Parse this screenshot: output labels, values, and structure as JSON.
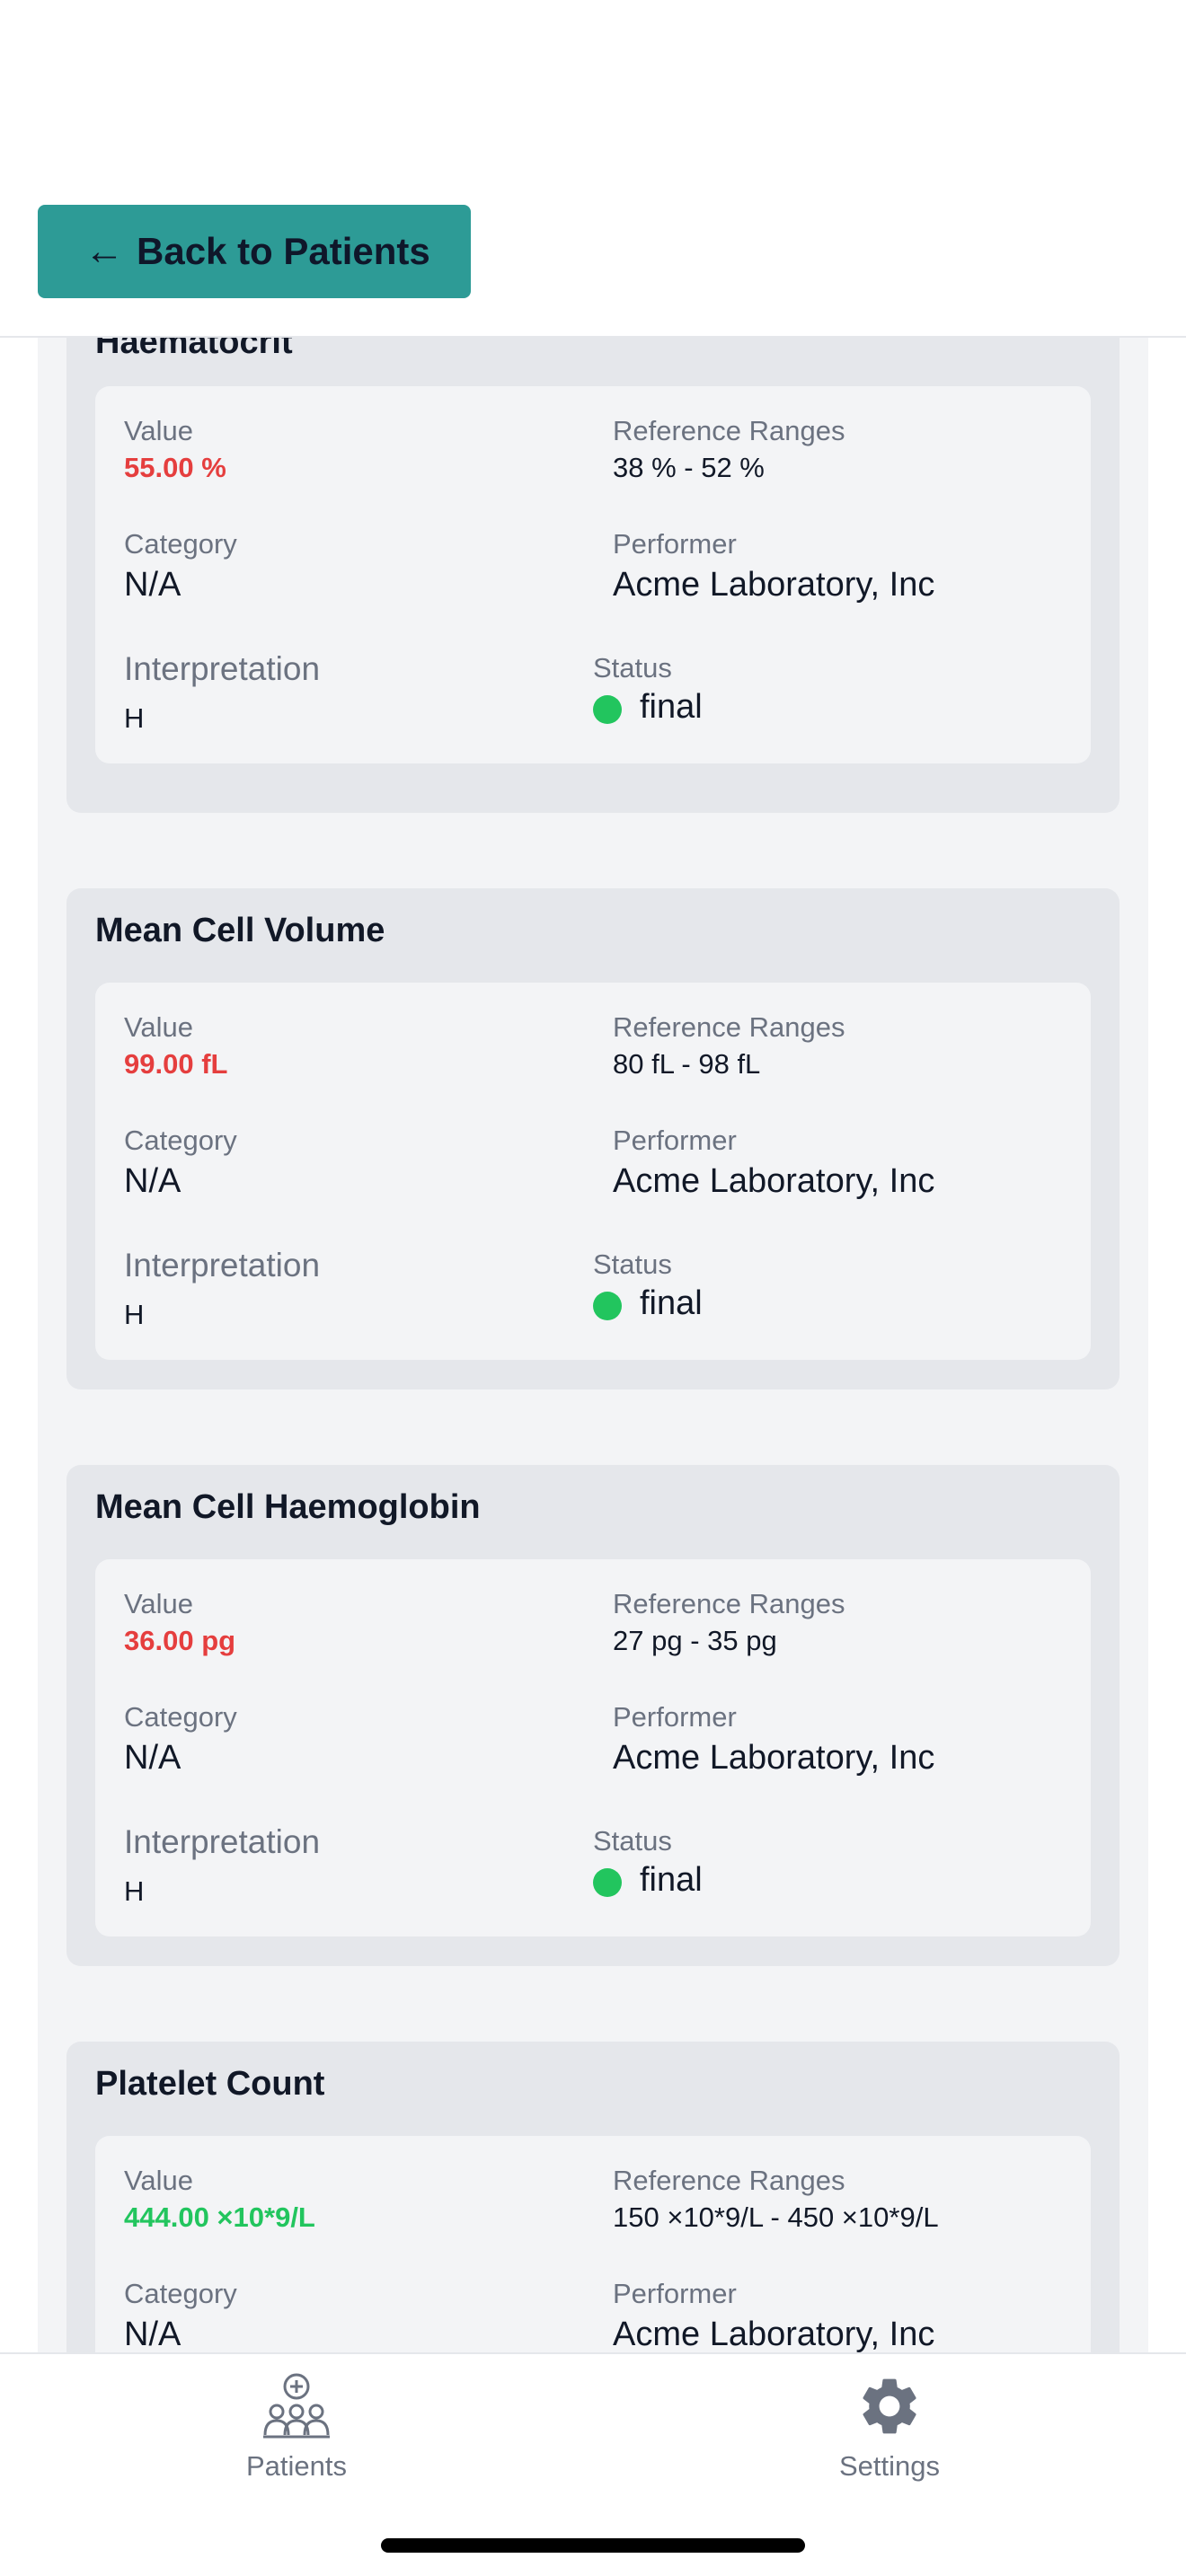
{
  "header": {
    "back_label": "Back to Patients"
  },
  "observations": [
    {
      "title": "Haematocrit",
      "value_label": "Value",
      "value": "55.00 %",
      "value_flag": "high",
      "ref_label": "Reference Ranges",
      "ref_value": "38 % - 52 %",
      "category_label": "Category",
      "category": "N/A",
      "performer_label": "Performer",
      "performer": "Acme Laboratory, Inc",
      "interp_label": "Interpretation",
      "interp": "H",
      "status_label": "Status",
      "status": "final"
    },
    {
      "title": "Mean Cell Volume",
      "value_label": "Value",
      "value": "99.00 fL",
      "value_flag": "high",
      "ref_label": "Reference Ranges",
      "ref_value": "80 fL - 98 fL",
      "category_label": "Category",
      "category": "N/A",
      "performer_label": "Performer",
      "performer": "Acme Laboratory, Inc",
      "interp_label": "Interpretation",
      "interp": "H",
      "status_label": "Status",
      "status": "final"
    },
    {
      "title": "Mean Cell Haemoglobin",
      "value_label": "Value",
      "value": "36.00 pg",
      "value_flag": "high",
      "ref_label": "Reference Ranges",
      "ref_value": "27 pg - 35 pg",
      "category_label": "Category",
      "category": "N/A",
      "performer_label": "Performer",
      "performer": "Acme Laboratory, Inc",
      "interp_label": "Interpretation",
      "interp": "H",
      "status_label": "Status",
      "status": "final"
    },
    {
      "title": "Platelet Count",
      "value_label": "Value",
      "value": "444.00 ×10*9/L",
      "value_flag": "normal",
      "ref_label": "Reference Ranges",
      "ref_value": "150 ×10*9/L - 450 ×10*9/L",
      "category_label": "Category",
      "category": "N/A",
      "performer_label": "Performer",
      "performer": "Acme Laboratory, Inc"
    }
  ],
  "tabbar": {
    "patients_label": "Patients",
    "settings_label": "Settings",
    "patients_icon": "patients-group-icon",
    "settings_icon": "gear-icon"
  },
  "colors": {
    "accent": "#2d9b96",
    "high": "#e53e3e",
    "normal": "#22c55e",
    "status_final": "#22c55e"
  }
}
